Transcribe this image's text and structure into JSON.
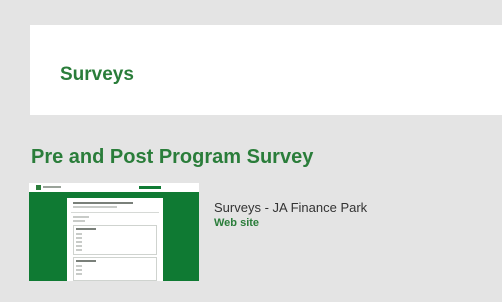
{
  "header": {
    "title": "Surveys"
  },
  "section": {
    "heading": "Pre and Post Program Survey",
    "resource": {
      "thumbnail_icon": "website-screenshot-thumbnail",
      "title": "Surveys - JA Finance Park",
      "type": "Web site"
    }
  },
  "colors": {
    "accent": "#2a7d3a",
    "thumbnail_bg": "#0f7a33",
    "page_bg": "#e4e4e4"
  }
}
